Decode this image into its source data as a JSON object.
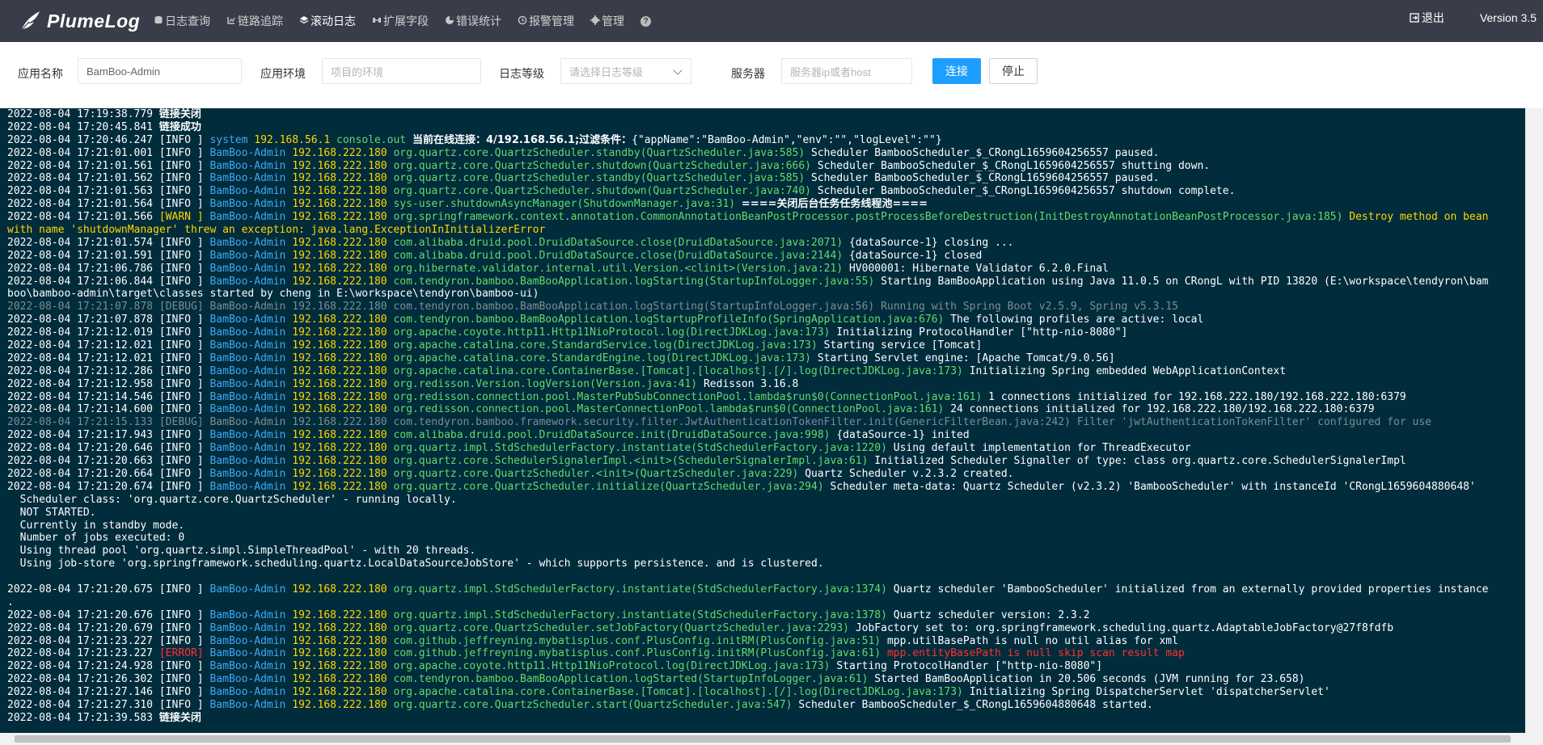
{
  "header": {
    "logo_text": "PlumeLog",
    "nav": [
      {
        "label": "日志查询",
        "icon": "db-icon"
      },
      {
        "label": "链路追踪",
        "icon": "trace-icon"
      },
      {
        "label": "滚动日志",
        "icon": "stream-icon",
        "active": true
      },
      {
        "label": "扩展字段",
        "icon": "extend-icon"
      },
      {
        "label": "错误统计",
        "icon": "chart-icon"
      },
      {
        "label": "报警管理",
        "icon": "alarm-icon"
      },
      {
        "label": "管理",
        "icon": "gear-icon"
      }
    ],
    "help_glyph": "?",
    "logout_label": "退出",
    "version": "Version 3.5"
  },
  "filters": {
    "app_name_label": "应用名称",
    "app_name_value": "BamBoo-Admin",
    "env_label": "应用环境",
    "env_placeholder": "项目的环境",
    "level_label": "日志等级",
    "level_placeholder": "请选择日志等级",
    "server_label": "服务器",
    "server_placeholder": "服务器ip或者host",
    "connect_label": "连接",
    "stop_label": "停止"
  },
  "colors": {
    "topbar": "#393d49",
    "console_bg": "#002c3c",
    "primary": "#1e9fff"
  },
  "log_lines": [
    [
      [
        "ts",
        "2022-08-04 17:19:38.779 "
      ],
      [
        "evt",
        "链接关闭"
      ]
    ],
    [
      [
        "ts",
        "2022-08-04 17:20:45.841 "
      ],
      [
        "evt",
        "链接成功"
      ]
    ],
    [
      [
        "ts",
        "2022-08-04 17:20:46.247 "
      ],
      [
        "info",
        "[INFO ] "
      ],
      [
        "app",
        "system "
      ],
      [
        "ip",
        "192.168.56.1 "
      ],
      [
        "cls",
        "console.out "
      ],
      [
        "evt",
        "当前在线连接：4/192.168.56.1;过滤条件："
      ],
      [
        "msg",
        "{\"appName\":\"BamBoo-Admin\",\"env\":\"\",\"logLevel\":\"\"}"
      ]
    ],
    [
      [
        "ts",
        "2022-08-04 17:21:01.001 "
      ],
      [
        "info",
        "[INFO ] "
      ],
      [
        "app",
        "BamBoo-Admin "
      ],
      [
        "ip",
        "192.168.222.180 "
      ],
      [
        "cls",
        "org.quartz.core.QuartzScheduler.standby(QuartzScheduler.java:585) "
      ],
      [
        "msg",
        "Scheduler BambooScheduler_$_CRongL1659604256557 paused."
      ]
    ],
    [
      [
        "ts",
        "2022-08-04 17:21:01.561 "
      ],
      [
        "info",
        "[INFO ] "
      ],
      [
        "app",
        "BamBoo-Admin "
      ],
      [
        "ip",
        "192.168.222.180 "
      ],
      [
        "cls",
        "org.quartz.core.QuartzScheduler.shutdown(QuartzScheduler.java:666) "
      ],
      [
        "msg",
        "Scheduler BambooScheduler_$_CRongL1659604256557 shutting down."
      ]
    ],
    [
      [
        "ts",
        "2022-08-04 17:21:01.562 "
      ],
      [
        "info",
        "[INFO ] "
      ],
      [
        "app",
        "BamBoo-Admin "
      ],
      [
        "ip",
        "192.168.222.180 "
      ],
      [
        "cls",
        "org.quartz.core.QuartzScheduler.standby(QuartzScheduler.java:585) "
      ],
      [
        "msg",
        "Scheduler BambooScheduler_$_CRongL1659604256557 paused."
      ]
    ],
    [
      [
        "ts",
        "2022-08-04 17:21:01.563 "
      ],
      [
        "info",
        "[INFO ] "
      ],
      [
        "app",
        "BamBoo-Admin "
      ],
      [
        "ip",
        "192.168.222.180 "
      ],
      [
        "cls",
        "org.quartz.core.QuartzScheduler.shutdown(QuartzScheduler.java:740) "
      ],
      [
        "msg",
        "Scheduler BambooScheduler_$_CRongL1659604256557 shutdown complete."
      ]
    ],
    [
      [
        "ts",
        "2022-08-04 17:21:01.564 "
      ],
      [
        "info",
        "[INFO ] "
      ],
      [
        "app",
        "BamBoo-Admin "
      ],
      [
        "ip",
        "192.168.222.180 "
      ],
      [
        "cls",
        "sys-user.shutdownAsyncManager(ShutdownManager.java:31) "
      ],
      [
        "evt",
        "====关闭后台任务任务线程池===="
      ]
    ],
    [
      [
        "ts",
        "2022-08-04 17:21:01.566 "
      ],
      [
        "warn",
        "[WARN ] "
      ],
      [
        "app",
        "BamBoo-Admin "
      ],
      [
        "ip",
        "192.168.222.180 "
      ],
      [
        "cls",
        "org.springframework.context.annotation.CommonAnnotationBeanPostProcessor.postProcessBeforeDestruction(InitDestroyAnnotationBeanPostProcessor.java:185) "
      ],
      [
        "warnmsg",
        "Destroy method on bean"
      ]
    ],
    [
      [
        "warnmsg",
        "with name 'shutdownManager' threw an exception: java.lang.ExceptionInInitializerError"
      ]
    ],
    [
      [
        "ts",
        "2022-08-04 17:21:01.574 "
      ],
      [
        "info",
        "[INFO ] "
      ],
      [
        "app",
        "BamBoo-Admin "
      ],
      [
        "ip",
        "192.168.222.180 "
      ],
      [
        "cls",
        "com.alibaba.druid.pool.DruidDataSource.close(DruidDataSource.java:2071) "
      ],
      [
        "msg",
        "{dataSource-1} closing ..."
      ]
    ],
    [
      [
        "ts",
        "2022-08-04 17:21:01.591 "
      ],
      [
        "info",
        "[INFO ] "
      ],
      [
        "app",
        "BamBoo-Admin "
      ],
      [
        "ip",
        "192.168.222.180 "
      ],
      [
        "cls",
        "com.alibaba.druid.pool.DruidDataSource.close(DruidDataSource.java:2144) "
      ],
      [
        "msg",
        "{dataSource-1} closed"
      ]
    ],
    [
      [
        "ts",
        "2022-08-04 17:21:06.786 "
      ],
      [
        "info",
        "[INFO ] "
      ],
      [
        "app",
        "BamBoo-Admin "
      ],
      [
        "ip",
        "192.168.222.180 "
      ],
      [
        "cls",
        "org.hibernate.validator.internal.util.Version.<clinit>(Version.java:21) "
      ],
      [
        "msg",
        "HV000001: Hibernate Validator 6.2.0.Final"
      ]
    ],
    [
      [
        "ts",
        "2022-08-04 17:21:06.844 "
      ],
      [
        "info",
        "[INFO ] "
      ],
      [
        "app",
        "BamBoo-Admin "
      ],
      [
        "ip",
        "192.168.222.180 "
      ],
      [
        "cls",
        "com.tendyron.bamboo.BamBooApplication.logStarting(StartupInfoLogger.java:55) "
      ],
      [
        "msg",
        "Starting BamBooApplication using Java 11.0.5 on CRongL with PID 13820 (E:\\workspace\\tendyron\\bam"
      ]
    ],
    [
      [
        "msg",
        "boo\\bamboo-admin\\target\\classes started by cheng in E:\\workspace\\tendyron\\bamboo-ui)"
      ]
    ],
    [
      [
        "debug",
        "2022-08-04 17:21:07.878 [DEBUG] BamBoo-Admin 192.168.222.180 com.tendyron.bamboo.BamBooApplication.logStarting(StartupInfoLogger.java:56) Running with Spring Boot v2.5.9, Spring v5.3.15"
      ]
    ],
    [
      [
        "ts",
        "2022-08-04 17:21:07.878 "
      ],
      [
        "info",
        "[INFO ] "
      ],
      [
        "app",
        "BamBoo-Admin "
      ],
      [
        "ip",
        "192.168.222.180 "
      ],
      [
        "cls",
        "com.tendyron.bamboo.BamBooApplication.logStartupProfileInfo(SpringApplication.java:676) "
      ],
      [
        "msg",
        "The following profiles are active: local"
      ]
    ],
    [
      [
        "ts",
        "2022-08-04 17:21:12.019 "
      ],
      [
        "info",
        "[INFO ] "
      ],
      [
        "app",
        "BamBoo-Admin "
      ],
      [
        "ip",
        "192.168.222.180 "
      ],
      [
        "cls",
        "org.apache.coyote.http11.Http11NioProtocol.log(DirectJDKLog.java:173) "
      ],
      [
        "msg",
        "Initializing ProtocolHandler [\"http-nio-8080\"]"
      ]
    ],
    [
      [
        "ts",
        "2022-08-04 17:21:12.021 "
      ],
      [
        "info",
        "[INFO ] "
      ],
      [
        "app",
        "BamBoo-Admin "
      ],
      [
        "ip",
        "192.168.222.180 "
      ],
      [
        "cls",
        "org.apache.catalina.core.StandardService.log(DirectJDKLog.java:173) "
      ],
      [
        "msg",
        "Starting service [Tomcat]"
      ]
    ],
    [
      [
        "ts",
        "2022-08-04 17:21:12.021 "
      ],
      [
        "info",
        "[INFO ] "
      ],
      [
        "app",
        "BamBoo-Admin "
      ],
      [
        "ip",
        "192.168.222.180 "
      ],
      [
        "cls",
        "org.apache.catalina.core.StandardEngine.log(DirectJDKLog.java:173) "
      ],
      [
        "msg",
        "Starting Servlet engine: [Apache Tomcat/9.0.56]"
      ]
    ],
    [
      [
        "ts",
        "2022-08-04 17:21:12.286 "
      ],
      [
        "info",
        "[INFO ] "
      ],
      [
        "app",
        "BamBoo-Admin "
      ],
      [
        "ip",
        "192.168.222.180 "
      ],
      [
        "cls",
        "org.apache.catalina.core.ContainerBase.[Tomcat].[localhost].[/].log(DirectJDKLog.java:173) "
      ],
      [
        "msg",
        "Initializing Spring embedded WebApplicationContext"
      ]
    ],
    [
      [
        "ts",
        "2022-08-04 17:21:12.958 "
      ],
      [
        "info",
        "[INFO ] "
      ],
      [
        "app",
        "BamBoo-Admin "
      ],
      [
        "ip",
        "192.168.222.180 "
      ],
      [
        "cls",
        "org.redisson.Version.logVersion(Version.java:41) "
      ],
      [
        "msg",
        "Redisson 3.16.8"
      ]
    ],
    [
      [
        "ts",
        "2022-08-04 17:21:14.546 "
      ],
      [
        "info",
        "[INFO ] "
      ],
      [
        "app",
        "BamBoo-Admin "
      ],
      [
        "ip",
        "192.168.222.180 "
      ],
      [
        "cls",
        "org.redisson.connection.pool.MasterPubSubConnectionPool.lambda$run$0(ConnectionPool.java:161) "
      ],
      [
        "msg",
        "1 connections initialized for 192.168.222.180/192.168.222.180:6379"
      ]
    ],
    [
      [
        "ts",
        "2022-08-04 17:21:14.600 "
      ],
      [
        "info",
        "[INFO ] "
      ],
      [
        "app",
        "BamBoo-Admin "
      ],
      [
        "ip",
        "192.168.222.180 "
      ],
      [
        "cls",
        "org.redisson.connection.pool.MasterConnectionPool.lambda$run$0(ConnectionPool.java:161) "
      ],
      [
        "msg",
        "24 connections initialized for 192.168.222.180/192.168.222.180:6379"
      ]
    ],
    [
      [
        "debug",
        "2022-08-04 17:21:15.133 [DEBUG] BamBoo-Admin 192.168.222.180 com.tendyron.bamboo.framework.security.filter.JwtAuthenticationTokenFilter.init(GenericFilterBean.java:242) Filter 'jwtAuthenticationTokenFilter' configured for use"
      ]
    ],
    [
      [
        "ts",
        "2022-08-04 17:21:17.943 "
      ],
      [
        "info",
        "[INFO ] "
      ],
      [
        "app",
        "BamBoo-Admin "
      ],
      [
        "ip",
        "192.168.222.180 "
      ],
      [
        "cls",
        "com.alibaba.druid.pool.DruidDataSource.init(DruidDataSource.java:998) "
      ],
      [
        "msg",
        "{dataSource-1} inited"
      ]
    ],
    [
      [
        "ts",
        "2022-08-04 17:21:20.646 "
      ],
      [
        "info",
        "[INFO ] "
      ],
      [
        "app",
        "BamBoo-Admin "
      ],
      [
        "ip",
        "192.168.222.180 "
      ],
      [
        "cls",
        "org.quartz.impl.StdSchedulerFactory.instantiate(StdSchedulerFactory.java:1220) "
      ],
      [
        "msg",
        "Using default implementation for ThreadExecutor"
      ]
    ],
    [
      [
        "ts",
        "2022-08-04 17:21:20.663 "
      ],
      [
        "info",
        "[INFO ] "
      ],
      [
        "app",
        "BamBoo-Admin "
      ],
      [
        "ip",
        "192.168.222.180 "
      ],
      [
        "cls",
        "org.quartz.core.SchedulerSignalerImpl.<init>(SchedulerSignalerImpl.java:61) "
      ],
      [
        "msg",
        "Initialized Scheduler Signaller of type: class org.quartz.core.SchedulerSignalerImpl"
      ]
    ],
    [
      [
        "ts",
        "2022-08-04 17:21:20.664 "
      ],
      [
        "info",
        "[INFO ] "
      ],
      [
        "app",
        "BamBoo-Admin "
      ],
      [
        "ip",
        "192.168.222.180 "
      ],
      [
        "cls",
        "org.quartz.core.QuartzScheduler.<init>(QuartzScheduler.java:229) "
      ],
      [
        "msg",
        "Quartz Scheduler v.2.3.2 created."
      ]
    ],
    [
      [
        "ts",
        "2022-08-04 17:21:20.674 "
      ],
      [
        "info",
        "[INFO ] "
      ],
      [
        "app",
        "BamBoo-Admin "
      ],
      [
        "ip",
        "192.168.222.180 "
      ],
      [
        "cls",
        "org.quartz.core.QuartzScheduler.initialize(QuartzScheduler.java:294) "
      ],
      [
        "msg",
        "Scheduler meta-data: Quartz Scheduler (v2.3.2) 'BambooScheduler' with instanceId 'CRongL1659604880648'"
      ]
    ],
    [
      [
        "msg",
        "  Scheduler class: 'org.quartz.core.QuartzScheduler' - running locally."
      ]
    ],
    [
      [
        "msg",
        "  NOT STARTED."
      ]
    ],
    [
      [
        "msg",
        "  Currently in standby mode."
      ]
    ],
    [
      [
        "msg",
        "  Number of jobs executed: 0"
      ]
    ],
    [
      [
        "msg",
        "  Using thread pool 'org.quartz.simpl.SimpleThreadPool' - with 20 threads."
      ]
    ],
    [
      [
        "msg",
        "  Using job-store 'org.springframework.scheduling.quartz.LocalDataSourceJobStore' - which supports persistence. and is clustered."
      ]
    ],
    [
      [
        "msg",
        ""
      ]
    ],
    [
      [
        "ts",
        "2022-08-04 17:21:20.675 "
      ],
      [
        "info",
        "[INFO ] "
      ],
      [
        "app",
        "BamBoo-Admin "
      ],
      [
        "ip",
        "192.168.222.180 "
      ],
      [
        "cls",
        "org.quartz.impl.StdSchedulerFactory.instantiate(StdSchedulerFactory.java:1374) "
      ],
      [
        "msg",
        "Quartz scheduler 'BambooScheduler' initialized from an externally provided properties instance"
      ]
    ],
    [
      [
        "msg",
        "."
      ]
    ],
    [
      [
        "ts",
        "2022-08-04 17:21:20.676 "
      ],
      [
        "info",
        "[INFO ] "
      ],
      [
        "app",
        "BamBoo-Admin "
      ],
      [
        "ip",
        "192.168.222.180 "
      ],
      [
        "cls",
        "org.quartz.impl.StdSchedulerFactory.instantiate(StdSchedulerFactory.java:1378) "
      ],
      [
        "msg",
        "Quartz scheduler version: 2.3.2"
      ]
    ],
    [
      [
        "ts",
        "2022-08-04 17:21:20.679 "
      ],
      [
        "info",
        "[INFO ] "
      ],
      [
        "app",
        "BamBoo-Admin "
      ],
      [
        "ip",
        "192.168.222.180 "
      ],
      [
        "cls",
        "org.quartz.core.QuartzScheduler.setJobFactory(QuartzScheduler.java:2293) "
      ],
      [
        "msg",
        "JobFactory set to: org.springframework.scheduling.quartz.AdaptableJobFactory@27f8fdfb"
      ]
    ],
    [
      [
        "ts",
        "2022-08-04 17:21:23.227 "
      ],
      [
        "info",
        "[INFO ] "
      ],
      [
        "app",
        "BamBoo-Admin "
      ],
      [
        "ip",
        "192.168.222.180 "
      ],
      [
        "cls",
        "com.github.jeffreyning.mybatisplus.conf.PlusConfig.initRM(PlusConfig.java:51) "
      ],
      [
        "msg",
        "mpp.utilBasePath is null no util alias for xml"
      ]
    ],
    [
      [
        "ts",
        "2022-08-04 17:21:23.227 "
      ],
      [
        "err",
        "[ERROR] "
      ],
      [
        "app",
        "BamBoo-Admin "
      ],
      [
        "ip",
        "192.168.222.180 "
      ],
      [
        "cls",
        "com.github.jeffreyning.mybatisplus.conf.PlusConfig.initRM(PlusConfig.java:61) "
      ],
      [
        "errmsg",
        "mpp.entityBasePath is null skip scan result map"
      ]
    ],
    [
      [
        "ts",
        "2022-08-04 17:21:24.928 "
      ],
      [
        "info",
        "[INFO ] "
      ],
      [
        "app",
        "BamBoo-Admin "
      ],
      [
        "ip",
        "192.168.222.180 "
      ],
      [
        "cls",
        "org.apache.coyote.http11.Http11NioProtocol.log(DirectJDKLog.java:173) "
      ],
      [
        "msg",
        "Starting ProtocolHandler [\"http-nio-8080\"]"
      ]
    ],
    [
      [
        "ts",
        "2022-08-04 17:21:26.302 "
      ],
      [
        "info",
        "[INFO ] "
      ],
      [
        "app",
        "BamBoo-Admin "
      ],
      [
        "ip",
        "192.168.222.180 "
      ],
      [
        "cls",
        "com.tendyron.bamboo.BamBooApplication.logStarted(StartupInfoLogger.java:61) "
      ],
      [
        "msg",
        "Started BamBooApplication in 20.506 seconds (JVM running for 23.658)"
      ]
    ],
    [
      [
        "ts",
        "2022-08-04 17:21:27.146 "
      ],
      [
        "info",
        "[INFO ] "
      ],
      [
        "app",
        "BamBoo-Admin "
      ],
      [
        "ip",
        "192.168.222.180 "
      ],
      [
        "cls",
        "org.apache.catalina.core.ContainerBase.[Tomcat].[localhost].[/].log(DirectJDKLog.java:173) "
      ],
      [
        "msg",
        "Initializing Spring DispatcherServlet 'dispatcherServlet'"
      ]
    ],
    [
      [
        "ts",
        "2022-08-04 17:21:27.310 "
      ],
      [
        "info",
        "[INFO ] "
      ],
      [
        "app",
        "BamBoo-Admin "
      ],
      [
        "ip",
        "192.168.222.180 "
      ],
      [
        "cls",
        "org.quartz.core.QuartzScheduler.start(QuartzScheduler.java:547) "
      ],
      [
        "msg",
        "Scheduler BambooScheduler_$_CRongL1659604880648 started."
      ]
    ],
    [
      [
        "ts",
        "2022-08-04 17:21:39.583 "
      ],
      [
        "evt",
        "链接关闭"
      ]
    ]
  ]
}
